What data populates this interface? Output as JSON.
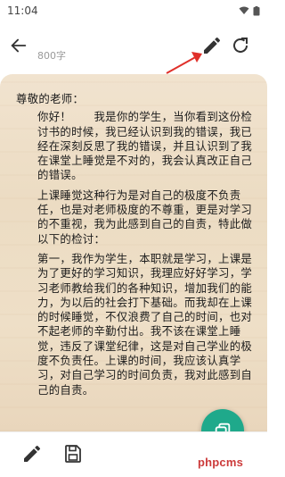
{
  "status_bar": {
    "time": "11:04"
  },
  "toolbar": {
    "word_count": "800字"
  },
  "letter": {
    "greeting": "尊敬的老师：",
    "paragraphs": [
      "你好！　　我是你的学生，当你看到这份检讨书的时候，我已经认识到我的错误，我已经在深刻反思了我的错误，并且认识到了我在课堂上睡觉是不对的，我会认真改正自己的错误。",
      "上课睡觉这种行为是对自己的极度不负责任，也是对老师极度的不尊重，更是对学习的不重视，我为此感到自己的自责，特此做以下的检讨：",
      "第一，我作为学生，本职就是学习，上课是为了更好的学习知识，我理应好好学习，学习老师教给我们的各种知识，增加我们的能力，为以后的社会打下基础。而我却在上课的时候睡觉，不仅浪费了自己的时间，也对不起老师的辛勤付出。我不该在课堂上睡觉，违反了课堂纪律，这是对自己学业的极度不负责任。上课的时间，我应该认真学习，对自己学习的时间负责，我对此感到自己的自责。"
    ]
  },
  "watermark": "phpcms",
  "colors": {
    "accent": "#1fa98b",
    "arrow": "#e0302a",
    "paper": "#efe1ca"
  }
}
